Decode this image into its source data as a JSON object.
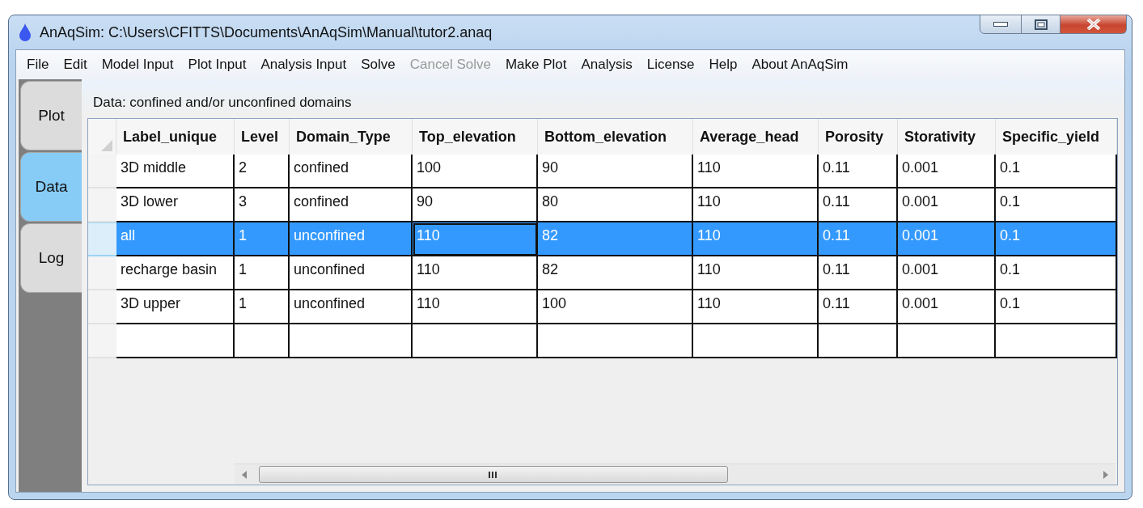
{
  "window": {
    "title": "AnAqSim: C:\\Users\\CFITTS\\Documents\\AnAqSim\\Manual\\tutor2.anaq"
  },
  "menu": [
    {
      "label": "File",
      "disabled": false
    },
    {
      "label": "Edit",
      "disabled": false
    },
    {
      "label": "Model Input",
      "disabled": false
    },
    {
      "label": "Plot Input",
      "disabled": false
    },
    {
      "label": "Analysis Input",
      "disabled": false
    },
    {
      "label": "Solve",
      "disabled": false
    },
    {
      "label": "Cancel Solve",
      "disabled": true
    },
    {
      "label": "Make Plot",
      "disabled": false
    },
    {
      "label": "Analysis",
      "disabled": false
    },
    {
      "label": "License",
      "disabled": false
    },
    {
      "label": "Help",
      "disabled": false
    },
    {
      "label": "About AnAqSim",
      "disabled": false
    }
  ],
  "tabs": [
    {
      "label": "Plot",
      "selected": false
    },
    {
      "label": "Data",
      "selected": true
    },
    {
      "label": "Log",
      "selected": false
    }
  ],
  "panel_title": "Data: confined and/or unconfined domains",
  "table": {
    "columns": [
      "Label_unique",
      "Level",
      "Domain_Type",
      "Top_elevation",
      "Bottom_elevation",
      "Average_head",
      "Porosity",
      "Storativity",
      "Specific_yield"
    ],
    "rows": [
      {
        "kind": "data",
        "selected": false,
        "cells": [
          {
            "text": "3D middle",
            "focused": false
          },
          {
            "text": "2",
            "focused": false
          },
          {
            "text": "confined",
            "focused": false
          },
          {
            "text": "100",
            "focused": false
          },
          {
            "text": "90",
            "focused": false
          },
          {
            "text": "110",
            "focused": false
          },
          {
            "text": "0.11",
            "focused": false
          },
          {
            "text": "0.001",
            "focused": false
          },
          {
            "text": "0.1",
            "focused": false
          }
        ]
      },
      {
        "kind": "data",
        "selected": false,
        "cells": [
          {
            "text": "3D lower",
            "focused": false
          },
          {
            "text": "3",
            "focused": false
          },
          {
            "text": "confined",
            "focused": false
          },
          {
            "text": "90",
            "focused": false
          },
          {
            "text": "80",
            "focused": false
          },
          {
            "text": "110",
            "focused": false
          },
          {
            "text": "0.11",
            "focused": false
          },
          {
            "text": "0.001",
            "focused": false
          },
          {
            "text": "0.1",
            "focused": false
          }
        ]
      },
      {
        "kind": "data",
        "selected": true,
        "cells": [
          {
            "text": "all",
            "focused": false
          },
          {
            "text": "1",
            "focused": false
          },
          {
            "text": "unconfined",
            "focused": false
          },
          {
            "text": "110",
            "focused": true
          },
          {
            "text": "82",
            "focused": false
          },
          {
            "text": "110",
            "focused": false
          },
          {
            "text": "0.11",
            "focused": false
          },
          {
            "text": "0.001",
            "focused": false
          },
          {
            "text": "0.1",
            "focused": false
          }
        ]
      },
      {
        "kind": "data",
        "selected": false,
        "cells": [
          {
            "text": "recharge basin",
            "focused": false
          },
          {
            "text": "1",
            "focused": false
          },
          {
            "text": "unconfined",
            "focused": false
          },
          {
            "text": "110",
            "focused": false
          },
          {
            "text": "82",
            "focused": false
          },
          {
            "text": "110",
            "focused": false
          },
          {
            "text": "0.11",
            "focused": false
          },
          {
            "text": "0.001",
            "focused": false
          },
          {
            "text": "0.1",
            "focused": false
          }
        ]
      },
      {
        "kind": "data",
        "selected": false,
        "cells": [
          {
            "text": "3D upper",
            "focused": false
          },
          {
            "text": "1",
            "focused": false
          },
          {
            "text": "unconfined",
            "focused": false
          },
          {
            "text": "110",
            "focused": false
          },
          {
            "text": "100",
            "focused": false
          },
          {
            "text": "110",
            "focused": false
          },
          {
            "text": "0.11",
            "focused": false
          },
          {
            "text": "0.001",
            "focused": false
          },
          {
            "text": "0.1",
            "focused": false
          }
        ]
      },
      {
        "kind": "new",
        "selected": false
      }
    ]
  }
}
